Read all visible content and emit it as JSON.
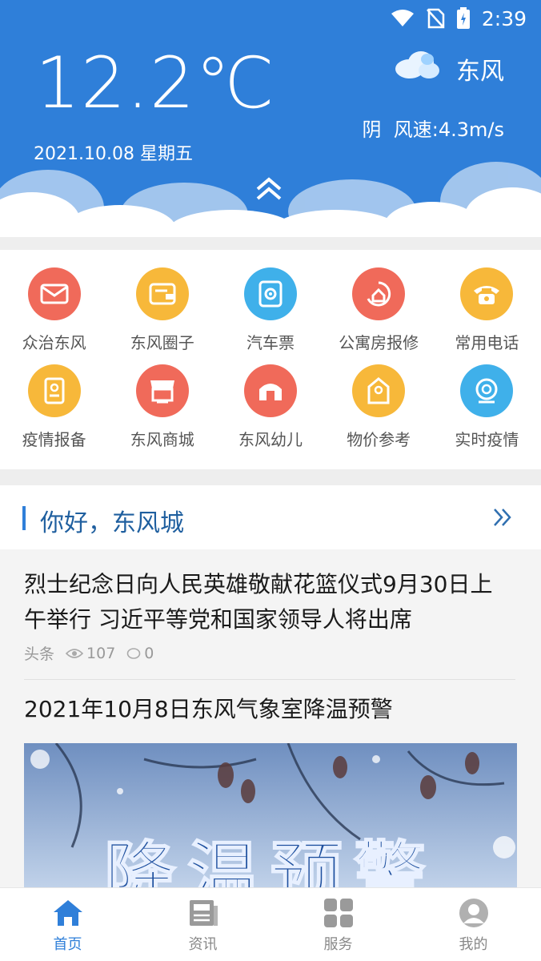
{
  "status_bar": {
    "time": "2:39"
  },
  "weather": {
    "temperature": "12.2℃",
    "wind_direction": "东风",
    "condition": "阴",
    "wind_speed": "风速:4.3m/s",
    "date": "2021.10.08",
    "weekday": "星期五"
  },
  "services": [
    {
      "label": "众治东风",
      "color": "#f06a5a",
      "icon": "mail-icon"
    },
    {
      "label": "东风圈子",
      "color": "#f7b83a",
      "icon": "wallet-icon"
    },
    {
      "label": "汽车票",
      "color": "#3fb0ea",
      "icon": "ticket-icon"
    },
    {
      "label": "公寓房报修",
      "color": "#f06a5a",
      "icon": "house-repair-icon"
    },
    {
      "label": "常用电话",
      "color": "#f7b83a",
      "icon": "phone-icon"
    },
    {
      "label": "疫情报备",
      "color": "#f7b83a",
      "icon": "report-icon"
    },
    {
      "label": "东风商城",
      "color": "#f06a5a",
      "icon": "shop-icon"
    },
    {
      "label": "东风幼儿",
      "color": "#f06a5a",
      "icon": "kindergarten-icon"
    },
    {
      "label": "物价参考",
      "color": "#f7b83a",
      "icon": "price-tag-icon"
    },
    {
      "label": "实时疫情",
      "color": "#3fb0ea",
      "icon": "virus-icon"
    }
  ],
  "news_section": {
    "title": "你好，东风城"
  },
  "news": [
    {
      "title": "烈士纪念日向人民英雄敬献花篮仪式9月30日上午举行 习近平等党和国家领导人将出席",
      "tag": "头条",
      "views": "107",
      "comments": "0"
    },
    {
      "title": "2021年10月8日东风气象室降温预警",
      "image_text": "降温预警"
    }
  ],
  "bottom_nav": [
    {
      "label": "首页",
      "icon": "home-icon",
      "active": true
    },
    {
      "label": "资讯",
      "icon": "news-icon",
      "active": false
    },
    {
      "label": "服务",
      "icon": "grid-icon",
      "active": false
    },
    {
      "label": "我的",
      "icon": "user-icon",
      "active": false
    }
  ],
  "colors": {
    "primary": "#2f7fd9",
    "red": "#f06a5a",
    "yellow": "#f7b83a",
    "blue": "#3fb0ea"
  }
}
